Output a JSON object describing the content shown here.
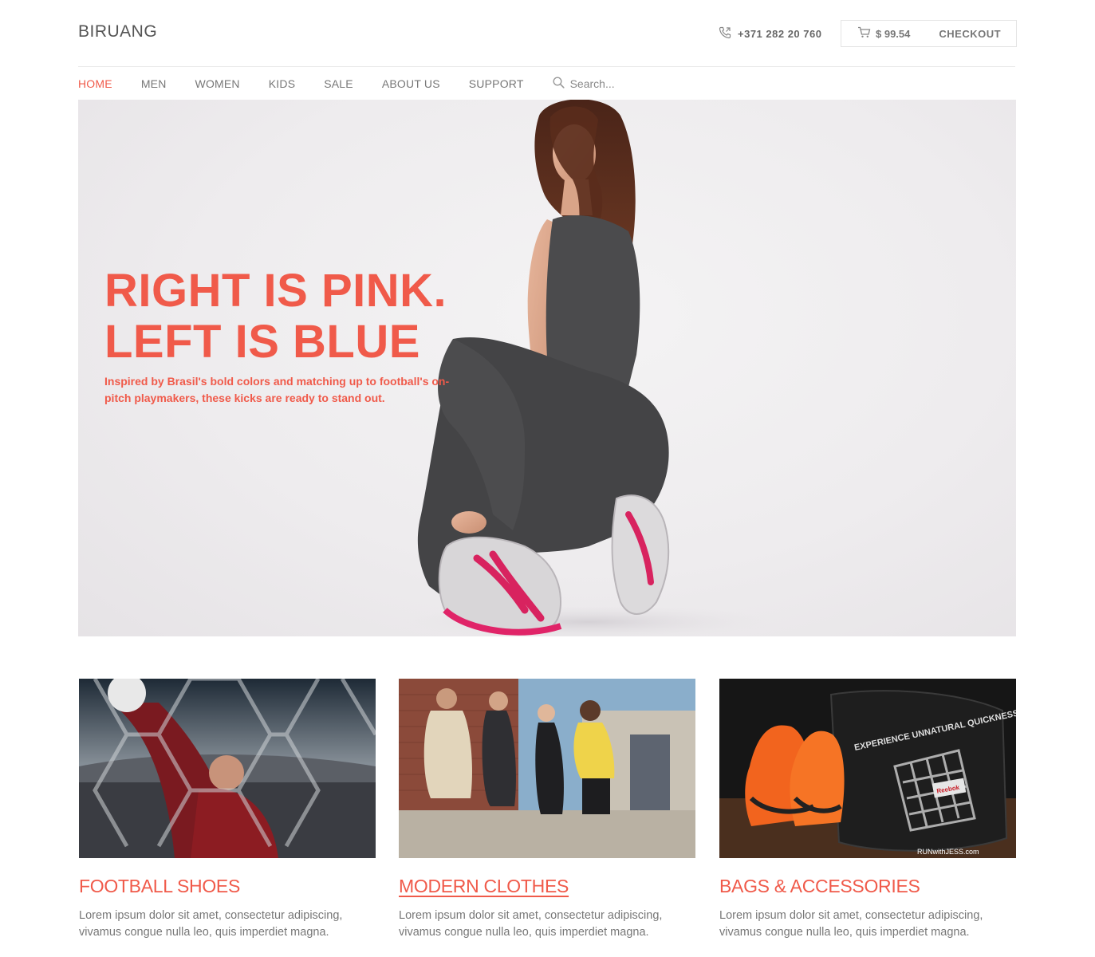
{
  "header": {
    "logo": "BIRUANG",
    "phone": "+371 282 20 760",
    "cart_total": "$ 99.54",
    "checkout_label": "CHECKOUT"
  },
  "nav": {
    "items": [
      {
        "label": "HOME"
      },
      {
        "label": "MEN"
      },
      {
        "label": "WOMEN"
      },
      {
        "label": "KIDS"
      },
      {
        "label": "SALE"
      },
      {
        "label": "ABOUT US"
      },
      {
        "label": "SUPPORT"
      }
    ],
    "active_index": 0,
    "search_placeholder": "Search..."
  },
  "hero": {
    "title_line1": "RIGHT IS PINK.",
    "title_line2": "LEFT IS BLUE",
    "subtitle": "Inspired by Brasil's bold colors and matching up to football's on-pitch playmakers, these kicks are ready to stand out."
  },
  "cards": [
    {
      "title": "FOOTBALL SHOES",
      "text": "Lorem ipsum dolor sit amet, consectetur adipiscing, vivamus congue nulla leo, quis imperdiet magna."
    },
    {
      "title": "MODERN CLOTHES",
      "text": "Lorem ipsum dolor sit amet, consectetur adipiscing, vivamus congue nulla leo, quis imperdiet magna."
    },
    {
      "title": "BAGS & ACCESSORIES",
      "text": "Lorem ipsum dolor sit amet, consectetur adipiscing, vivamus congue nulla leo, quis imperdiet magna.",
      "image_text": "EXPERIENCE UNNATURAL QUICKNESS.",
      "image_brand": "Reebok",
      "image_watermark": "RUNwithJESS.com"
    }
  ],
  "colors": {
    "accent": "#f05a4a",
    "text": "#777777"
  }
}
